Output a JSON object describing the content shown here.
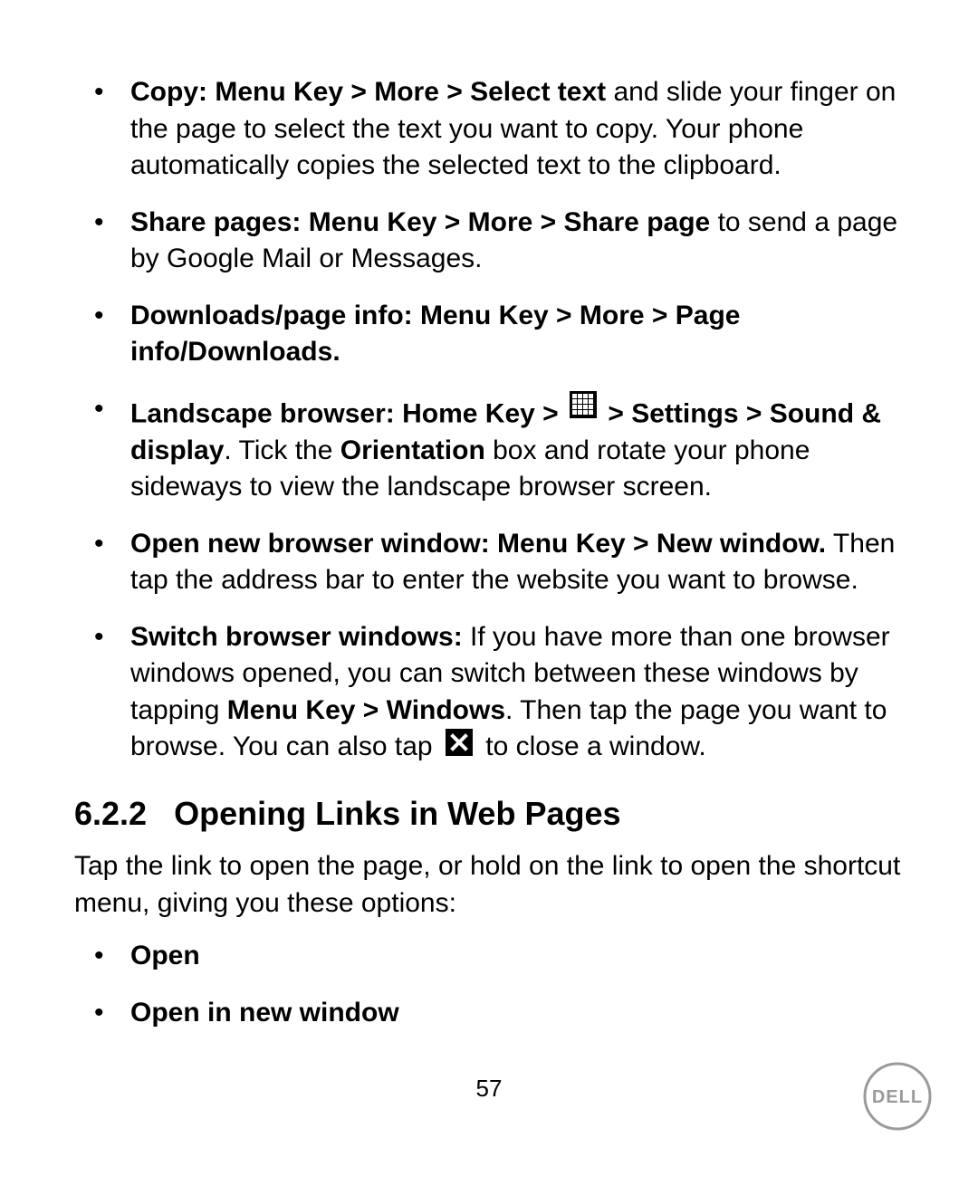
{
  "bullets": {
    "copy": {
      "bold": "Copy: Menu Key > More > Select text",
      "rest": " and slide your finger on the page to select the text you want to copy. Your phone automatically copies the selected text to the clipboard."
    },
    "share": {
      "bold": "Share pages: Menu Key > More > Share page",
      "rest": " to send a page by Google Mail or Messages."
    },
    "downloads": {
      "bold": "Downloads/page info: Menu Key > More > Page info/Downloads."
    },
    "landscape": {
      "bold_pre": "Landscape browser: Home Key > ",
      "bold_post": " > Settings > Sound & display",
      "rest1": ". Tick the ",
      "bold_orientation": "Orientation",
      "rest2": " box and rotate your phone sideways to view the landscape browser screen."
    },
    "newwindow": {
      "bold": "Open new browser window: Menu Key > New window.",
      "rest": " Then tap the address bar to enter the website you want to browse."
    },
    "switch": {
      "bold1": "Switch browser windows:",
      "rest1": " If you have more than one browser windows opened, you can switch between these windows by tapping ",
      "bold2": "Menu Key > Windows",
      "rest2": ". Then tap the page you want to browse. You can also tap ",
      "rest3": " to close a window."
    }
  },
  "section": {
    "number": "6.2.2",
    "title": "Opening Links in Web Pages",
    "intro": "Tap the link to open the page, or hold on the link to open the shortcut menu, giving you these options:",
    "options": {
      "open": "Open",
      "open_new": "Open in new window"
    }
  },
  "page_number": "57",
  "logo_text": "DELL"
}
